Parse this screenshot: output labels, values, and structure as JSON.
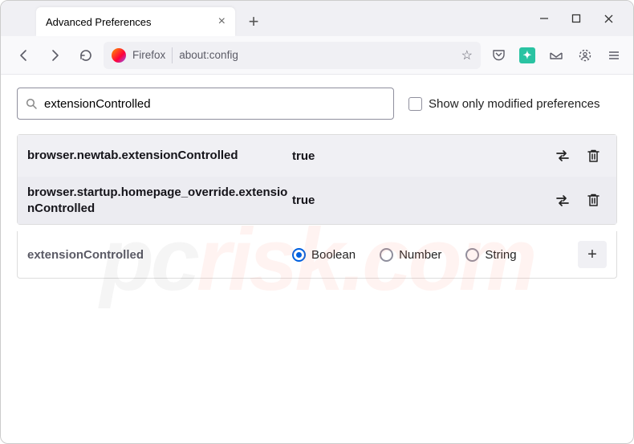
{
  "tab": {
    "title": "Advanced Preferences"
  },
  "urlbar": {
    "label_firefox": "Firefox",
    "address": "about:config"
  },
  "search": {
    "value": "extensionControlled"
  },
  "show_modified_label": "Show only modified preferences",
  "prefs": [
    {
      "name": "browser.newtab.extensionControlled",
      "value": "true"
    },
    {
      "name": "browser.startup.homepage_override.extensionControlled",
      "value": "true"
    }
  ],
  "newpref": {
    "name": "extensionControlled",
    "types": [
      "Boolean",
      "Number",
      "String"
    ],
    "selected": 0
  },
  "watermark": {
    "a": "pc",
    "b": "risk.com"
  }
}
